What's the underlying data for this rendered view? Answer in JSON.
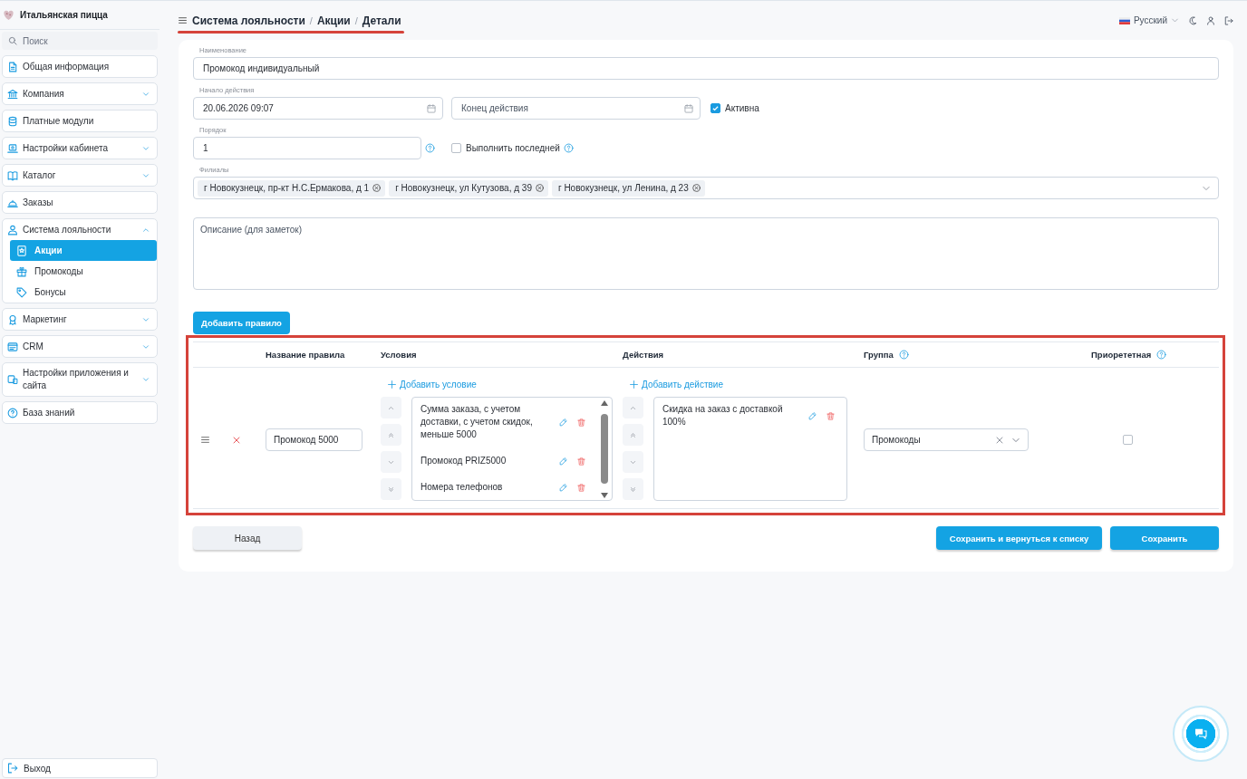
{
  "sidebar": {
    "brand": "Итальянская пицца",
    "search": {
      "placeholder": "Поиск"
    },
    "items": [
      {
        "label": "Общая информация",
        "kind": "link",
        "selected": false
      },
      {
        "label": "Компания",
        "kind": "group",
        "selected": false,
        "expanded": false
      },
      {
        "label": "Платные модули",
        "kind": "link",
        "selected": false
      },
      {
        "label": "Настройки кабинета",
        "kind": "group",
        "selected": false,
        "expanded": false
      },
      {
        "label": "Каталог",
        "kind": "group",
        "selected": false,
        "expanded": false
      },
      {
        "label": "Заказы",
        "kind": "link",
        "selected": false
      },
      {
        "label": "Система лояльности",
        "kind": "group",
        "selected": false,
        "expanded": true,
        "children": [
          {
            "label": "Акции",
            "selected": true
          },
          {
            "label": "Промокоды",
            "selected": false
          },
          {
            "label": "Бонусы",
            "selected": false
          }
        ]
      },
      {
        "label": "Маркетинг",
        "kind": "group",
        "selected": false,
        "expanded": false
      },
      {
        "label": "CRM",
        "kind": "group",
        "selected": false,
        "expanded": false
      },
      {
        "label": "Настройки приложения и сайта",
        "kind": "group",
        "selected": false,
        "expanded": false
      },
      {
        "label": "База знаний",
        "kind": "link",
        "selected": false
      }
    ],
    "logout": "Выход"
  },
  "header": {
    "breadcrumb": [
      {
        "label": "Система лояльности"
      },
      {
        "label": "Акции",
        "separator": "/"
      },
      {
        "label": "Детали",
        "separator": "/"
      }
    ],
    "language": "Русский"
  },
  "form": {
    "name": {
      "label": "Наименование",
      "value": "Промокод индивидуальный"
    },
    "start": {
      "label": "Начало действия",
      "value": "20.06.2026 09:07"
    },
    "end": {
      "placeholder": "Конец действия"
    },
    "active": {
      "label": "Активна",
      "checked": true
    },
    "order": {
      "label": "Порядок",
      "value": "1"
    },
    "run_last": {
      "label": "Выполнить последней",
      "checked": false
    },
    "branches": {
      "label": "Филиалы",
      "values": [
        "г Новокузнецк, пр-кт Н.С.Ермакова, д 1",
        "г Новокузнецк, ул Кутузова, д 39",
        "г Новокузнецк, ул Ленина, д 23"
      ]
    },
    "description": {
      "placeholder": "Описание (для заметок)"
    },
    "add_rule": "Добавить правило"
  },
  "rules": {
    "columns": [
      {
        "label": "Название правила",
        "help": false
      },
      {
        "label": "Условия",
        "help": false
      },
      {
        "label": "Действия",
        "help": false
      },
      {
        "label": "Группа",
        "help": true
      },
      {
        "label": "Приорететная",
        "help": true
      }
    ],
    "rows": [
      {
        "name": "Промокод 5000",
        "add_condition": "Добавить условие",
        "conditions": [
          "Сумма заказа, с учетом доставки, с учетом скидок, меньше 5000",
          "Промокод PRIZ5000",
          "Номера телефонов"
        ],
        "add_action": "Добавить действие",
        "actions": [
          "Скидка на заказ с доставкой 100%"
        ],
        "group": "Промокоды",
        "priority": false
      }
    ]
  },
  "footer": {
    "back": "Назад",
    "save_and_return": "Сохранить и вернуться к списку",
    "save": "Сохранить"
  }
}
